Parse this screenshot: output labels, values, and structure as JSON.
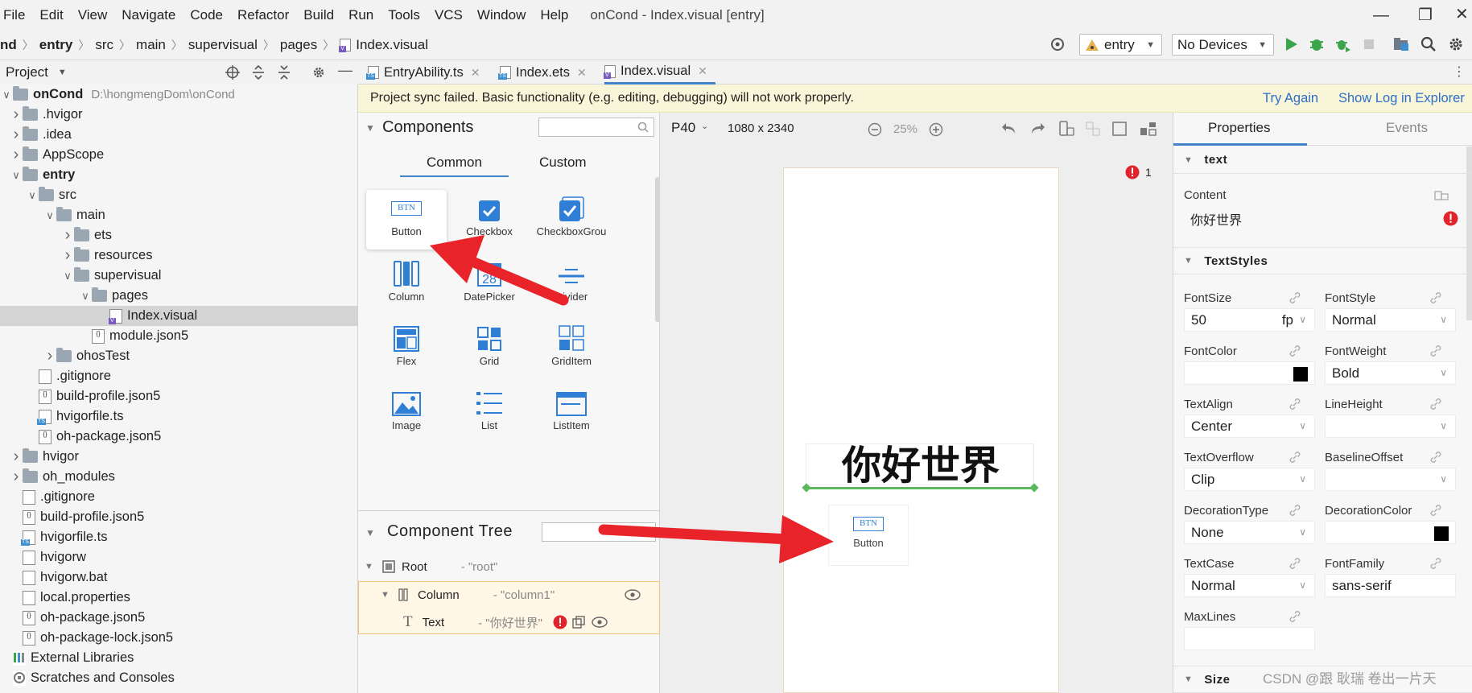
{
  "menu": [
    "File",
    "Edit",
    "View",
    "Navigate",
    "Code",
    "Refactor",
    "Build",
    "Run",
    "Tools",
    "VCS",
    "Window",
    "Help"
  ],
  "window_title": "onCond - Index.visual [entry]",
  "breadcrumb": [
    "nd",
    "entry",
    "src",
    "main",
    "supervisual",
    "pages",
    "Index.visual"
  ],
  "run_config": "entry",
  "device": "No Devices",
  "project_panel": {
    "title": "Project"
  },
  "tree": [
    {
      "label": "onCond",
      "extra": "D:\\hongmengDom\\onCond",
      "type": "folder",
      "bold": true
    },
    {
      "label": ".hvigor",
      "type": "folder"
    },
    {
      "label": ".idea",
      "type": "folder"
    },
    {
      "label": "AppScope",
      "type": "folder"
    },
    {
      "label": "entry",
      "type": "folder",
      "bold": true
    },
    {
      "label": "src",
      "type": "folder"
    },
    {
      "label": "main",
      "type": "folder"
    },
    {
      "label": "ets",
      "type": "folder"
    },
    {
      "label": "resources",
      "type": "folder"
    },
    {
      "label": "supervisual",
      "type": "folder"
    },
    {
      "label": "pages",
      "type": "folder"
    },
    {
      "label": "Index.visual",
      "type": "visual",
      "selected": true
    },
    {
      "label": "module.json5",
      "type": "json"
    },
    {
      "label": "ohosTest",
      "type": "folder"
    },
    {
      "label": ".gitignore",
      "type": "file"
    },
    {
      "label": "build-profile.json5",
      "type": "json"
    },
    {
      "label": "hvigorfile.ts",
      "type": "ts"
    },
    {
      "label": "oh-package.json5",
      "type": "json"
    },
    {
      "label": "hvigor",
      "type": "folder"
    },
    {
      "label": "oh_modules",
      "type": "folder"
    },
    {
      "label": ".gitignore",
      "type": "file"
    },
    {
      "label": "build-profile.json5",
      "type": "json"
    },
    {
      "label": "hvigorfile.ts",
      "type": "ts"
    },
    {
      "label": "hvigorw",
      "type": "file"
    },
    {
      "label": "hvigorw.bat",
      "type": "file"
    },
    {
      "label": "local.properties",
      "type": "file"
    },
    {
      "label": "oh-package.json5",
      "type": "json"
    },
    {
      "label": "oh-package-lock.json5",
      "type": "json"
    },
    {
      "label": "External Libraries",
      "type": "lib"
    },
    {
      "label": "Scratches and Consoles",
      "type": "scratch"
    }
  ],
  "tabs": [
    "EntryAbility.ts",
    "Index.ets",
    "Index.visual"
  ],
  "banner": {
    "message": "Project sync failed. Basic functionality (e.g. editing, debugging) will not work properly.",
    "try_again": "Try Again",
    "show_log": "Show Log in Explorer"
  },
  "components": {
    "title": "Components",
    "tabs": [
      "Common",
      "Custom"
    ],
    "items": [
      "Button",
      "Checkbox",
      "CheckboxGrou",
      "Column",
      "DatePicker",
      "Divider",
      "Flex",
      "Grid",
      "GridItem",
      "Image",
      "List",
      "ListItem"
    ],
    "datepicker_day": "28",
    "btn_text": "BTN"
  },
  "component_tree": {
    "title": "Component Tree",
    "nodes": [
      {
        "name": "Root",
        "id": "- \"root\""
      },
      {
        "name": "Column",
        "id": "- \"column1\""
      },
      {
        "name": "Text",
        "id": "- \"你好世界\""
      }
    ]
  },
  "canvas": {
    "device": "P40",
    "resolution": "1080 x 2340",
    "zoom": "25%",
    "error_count": "1",
    "text": "你好世界",
    "dragged_button": "Button",
    "dragged_btn_text": "BTN"
  },
  "properties": {
    "tabs": [
      "Properties",
      "Events"
    ],
    "text_section": "text",
    "content_label": "Content",
    "content_value": "你好世界",
    "textstyles_section": "TextStyles",
    "fields": [
      {
        "label": "FontSize",
        "value": "50",
        "unit": "fp"
      },
      {
        "label": "FontStyle",
        "value": "Normal"
      },
      {
        "label": "FontColor",
        "value": "",
        "swatch": "#000000"
      },
      {
        "label": "FontWeight",
        "value": "Bold"
      },
      {
        "label": "TextAlign",
        "value": "Center"
      },
      {
        "label": "LineHeight",
        "value": ""
      },
      {
        "label": "TextOverflow",
        "value": "Clip"
      },
      {
        "label": "BaselineOffset",
        "value": ""
      },
      {
        "label": "DecorationType",
        "value": "None"
      },
      {
        "label": "DecorationColor",
        "value": "",
        "swatch": "#000000"
      },
      {
        "label": "TextCase",
        "value": "Normal"
      },
      {
        "label": "FontFamily",
        "value": "sans-serif"
      },
      {
        "label": "MaxLines",
        "value": ""
      }
    ],
    "size_section": "Size"
  },
  "watermark": "CSDN @跟 耿瑞 卷出一片天",
  "colors": {
    "accent": "#4083c9",
    "error": "#e0242b",
    "arrow": "#e8232a",
    "banner": "#f9f5d8",
    "green": "#5cb85c"
  }
}
